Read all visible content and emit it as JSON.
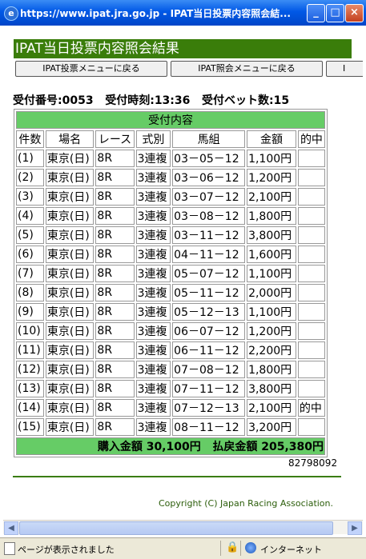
{
  "window": {
    "title": "https://www.ipat.jra.go.jp - IPAT当日投票内容照会結...",
    "minimize": "_",
    "maximize": "□",
    "close": "×"
  },
  "page": {
    "heading": "IPAT当日投票内容照会結果",
    "nav": {
      "menu_button": "IPAT投票メニューに戻る",
      "inquiry_button": "IPAT照会メニューに戻る",
      "extra_button": "I"
    },
    "receipt": {
      "number_label": "受付番号:",
      "number": "0053",
      "time_label": "受付時刻:",
      "time": "13:36",
      "count_label": "受付ベット数:",
      "count": "15"
    },
    "table": {
      "caption": "受付内容",
      "headers": [
        "件数",
        "場名",
        "レース",
        "式別",
        "馬組",
        "金額",
        "的中"
      ],
      "rows": [
        [
          "(1)",
          "東京(日)",
          "8R",
          "3連複",
          "03－05－12",
          "1,100円",
          ""
        ],
        [
          "(2)",
          "東京(日)",
          "8R",
          "3連複",
          "03－06－12",
          "1,200円",
          ""
        ],
        [
          "(3)",
          "東京(日)",
          "8R",
          "3連複",
          "03－07－12",
          "2,100円",
          ""
        ],
        [
          "(4)",
          "東京(日)",
          "8R",
          "3連複",
          "03－08－12",
          "1,800円",
          ""
        ],
        [
          "(5)",
          "東京(日)",
          "8R",
          "3連複",
          "03－11－12",
          "3,800円",
          ""
        ],
        [
          "(6)",
          "東京(日)",
          "8R",
          "3連複",
          "04－11－12",
          "1,600円",
          ""
        ],
        [
          "(7)",
          "東京(日)",
          "8R",
          "3連複",
          "05－07－12",
          "1,100円",
          ""
        ],
        [
          "(8)",
          "東京(日)",
          "8R",
          "3連複",
          "05－11－12",
          "2,000円",
          ""
        ],
        [
          "(9)",
          "東京(日)",
          "8R",
          "3連複",
          "05－12－13",
          "1,100円",
          ""
        ],
        [
          "(10)",
          "東京(日)",
          "8R",
          "3連複",
          "06－07－12",
          "1,200円",
          ""
        ],
        [
          "(11)",
          "東京(日)",
          "8R",
          "3連複",
          "06－11－12",
          "2,200円",
          ""
        ],
        [
          "(12)",
          "東京(日)",
          "8R",
          "3連複",
          "07－08－12",
          "1,800円",
          ""
        ],
        [
          "(13)",
          "東京(日)",
          "8R",
          "3連複",
          "07－11－12",
          "3,800円",
          ""
        ],
        [
          "(14)",
          "東京(日)",
          "8R",
          "3連複",
          "07－12－13",
          "2,100円",
          "的中"
        ],
        [
          "(15)",
          "東京(日)",
          "8R",
          "3連複",
          "08－11－12",
          "3,200円",
          ""
        ]
      ],
      "total": {
        "purchase_label": "購入金額",
        "purchase": "30,100円",
        "refund_label": "払戻金額",
        "refund": "205,380円"
      }
    },
    "serial": "82798092",
    "copyright": "Copyright (C) Japan Racing Association."
  },
  "statusbar": {
    "text": "ページが表示されました",
    "zone": "インターネット"
  },
  "colors": {
    "header_bg": "#3a7d0a",
    "table_caption_bg": "#66cc66",
    "title_bar": "#0058e6"
  },
  "icons": [
    "ie-logo-icon",
    "page-icon",
    "lock-icon",
    "globe-icon"
  ]
}
